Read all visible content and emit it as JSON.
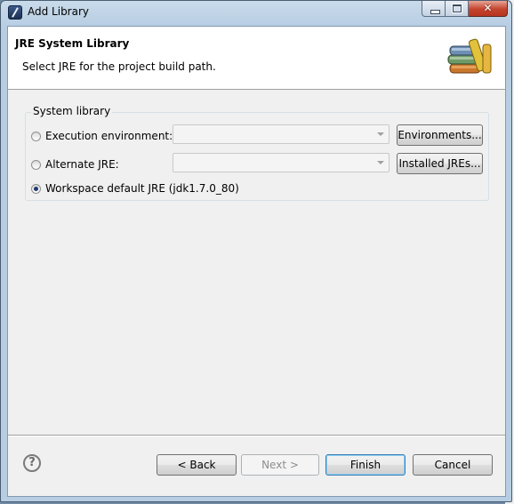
{
  "window": {
    "title": "Add Library"
  },
  "header": {
    "title": "JRE System Library",
    "message": "Select JRE for the project build path."
  },
  "group": {
    "label": "System library",
    "options": [
      {
        "label": "Execution environment:",
        "checked": false
      },
      {
        "label": "Alternate JRE:",
        "checked": false
      },
      {
        "label": "Workspace default JRE (jdk1.7.0_80)",
        "checked": true
      }
    ],
    "execution_env_value": "",
    "alternate_jre_value": "",
    "environments_button": "Environments...",
    "installed_jres_button": "Installed JREs..."
  },
  "footer": {
    "help_symbol": "?",
    "back_button": "< Back",
    "next_button": "Next >",
    "finish_button": "Finish",
    "cancel_button": "Cancel"
  },
  "icons": {
    "title_icon": "eclipse-icon",
    "header_image": "library-books-icon",
    "help": "help-icon"
  }
}
